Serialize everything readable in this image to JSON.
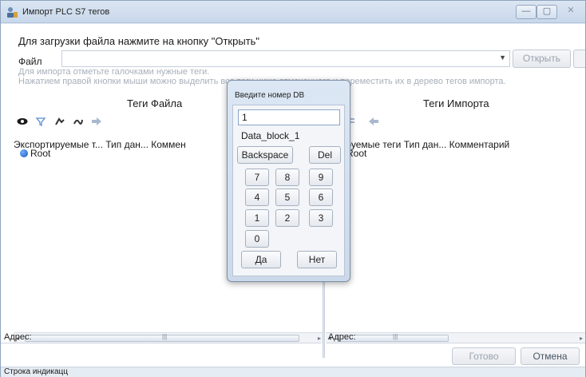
{
  "window": {
    "title": "Импорт PLC S7 тегов",
    "controls": {
      "minimize": "—",
      "maximize": "▢",
      "close": "✕"
    }
  },
  "header": {
    "hint": "Для загрузки файла нажмите на кнопку \"Открыть\"",
    "file_label": "Файл",
    "file_value": "",
    "open_button": "Открыть",
    "info_line1": "Для импорта отметьте галочками нужные теги.",
    "info_line2": "Нажатием правой кнопки мыши можно выделить все теги ниже отмеченного и переместить их в дерево тегов импорта."
  },
  "left_panel": {
    "title": "Теги Файла",
    "columns": "Экспортируемые т...  Тип дан...  Коммен",
    "root": "Root",
    "address_label": "Адрес:"
  },
  "right_panel": {
    "title": "Теги Импорта",
    "columns": "ортируемые теги  Тип дан...  Комментарий",
    "root": "Root",
    "address_label": "Адрес:"
  },
  "footer": {
    "done_button": "Готово",
    "cancel_button": "Отмена",
    "status": "Строка индикацц"
  },
  "dialog": {
    "title": "Введите номер DB",
    "input_value": "1",
    "block_name": "Data_block_1",
    "backspace": "Backspace",
    "del": "Del",
    "keys": [
      "7",
      "8",
      "9",
      "4",
      "5",
      "6",
      "1",
      "2",
      "3",
      "0"
    ],
    "yes": "Да",
    "no": "Нет"
  }
}
